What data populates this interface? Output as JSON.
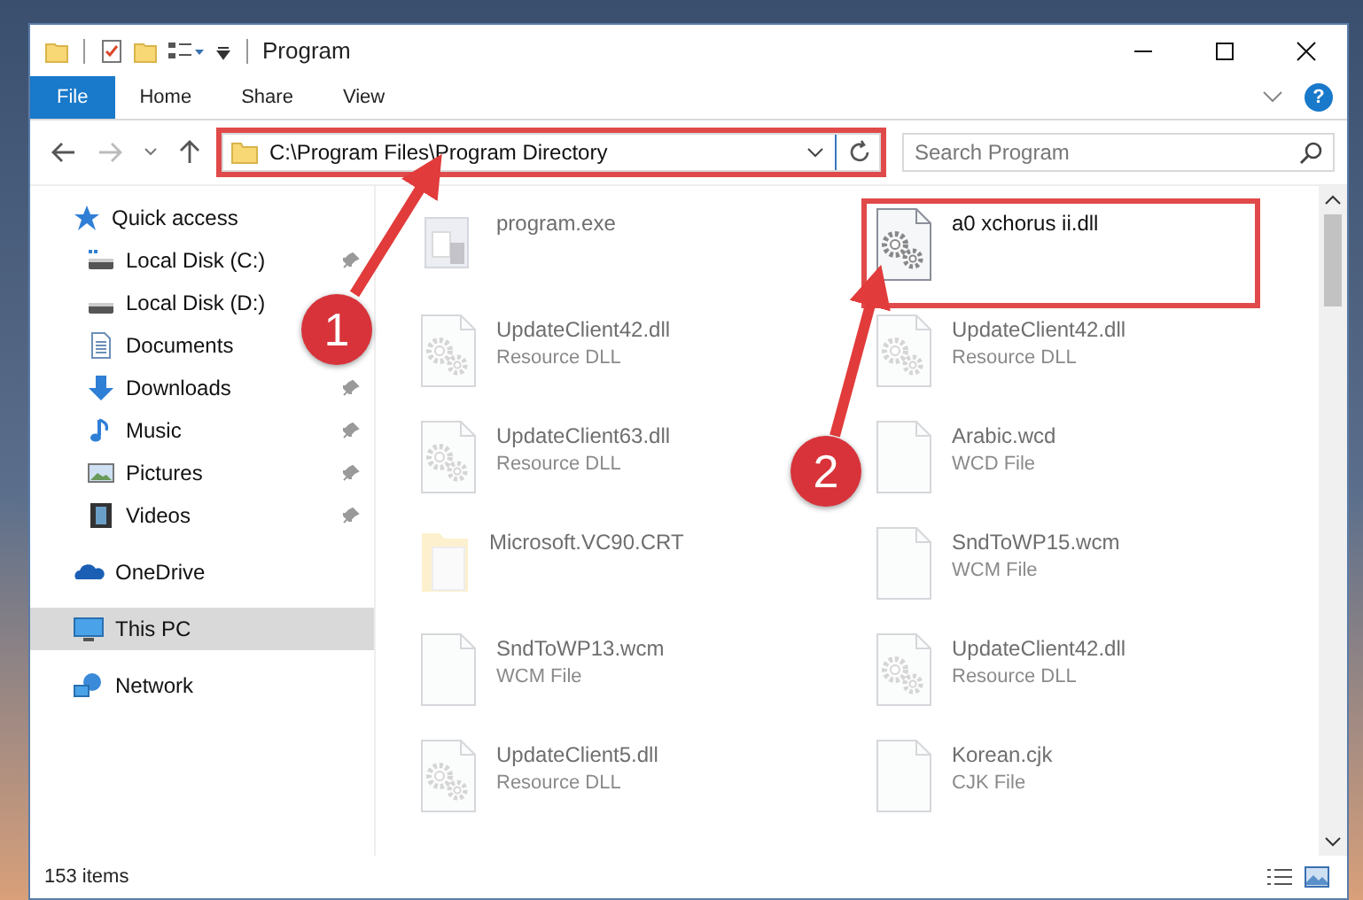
{
  "window": {
    "title": "Program"
  },
  "ribbon": {
    "tabs": [
      {
        "label": "File",
        "selected": true
      },
      {
        "label": "Home",
        "selected": false
      },
      {
        "label": "Share",
        "selected": false
      },
      {
        "label": "View",
        "selected": false
      }
    ],
    "help": "?"
  },
  "address": {
    "path": "C:\\Program Files\\Program Directory",
    "highlighted": true
  },
  "search": {
    "placeholder": "Search Program"
  },
  "sidebar": {
    "items": [
      {
        "label": "Quick access",
        "kind": "star",
        "selected": false,
        "children": [
          {
            "label": "Local Disk (C:)",
            "kind": "drive-c",
            "pinned": true
          },
          {
            "label": "Local Disk (D:)",
            "kind": "drive",
            "pinned": false
          },
          {
            "label": "Documents",
            "kind": "documents",
            "pinned": false
          },
          {
            "label": "Downloads",
            "kind": "downloads",
            "pinned": true
          },
          {
            "label": "Music",
            "kind": "music",
            "pinned": true
          },
          {
            "label": "Pictures",
            "kind": "pictures",
            "pinned": true
          },
          {
            "label": "Videos",
            "kind": "videos",
            "pinned": true
          }
        ]
      },
      {
        "label": "OneDrive",
        "kind": "cloud",
        "selected": false
      },
      {
        "label": "This PC",
        "kind": "pc",
        "selected": true
      },
      {
        "label": "Network",
        "kind": "network",
        "selected": false
      }
    ]
  },
  "files": [
    {
      "name": "program.exe",
      "kind": "exe",
      "dimmed": true,
      "highlighted": false
    },
    {
      "name": "a0 xchorus ii.dll",
      "kind": "dll",
      "dimmed": false,
      "highlighted": true
    },
    {
      "name": "UpdateClient42.dll",
      "type": "Resource DLL",
      "kind": "dll",
      "dimmed": true,
      "highlighted": false
    },
    {
      "name": "UpdateClient42.dll",
      "type": "Resource DLL",
      "kind": "dll",
      "dimmed": true,
      "highlighted": false
    },
    {
      "name": "UpdateClient63.dll",
      "type": "Resource DLL",
      "kind": "dll",
      "dimmed": true,
      "highlighted": false
    },
    {
      "name": "Arabic.wcd",
      "type": "WCD File",
      "kind": "file",
      "dimmed": true,
      "highlighted": false
    },
    {
      "name": "Microsoft.VC90.CRT",
      "kind": "folder",
      "dimmed": true,
      "highlighted": false
    },
    {
      "name": "SndToWP15.wcm",
      "type": "WCM File",
      "kind": "file",
      "dimmed": true,
      "highlighted": false
    },
    {
      "name": "SndToWP13.wcm",
      "type": "WCM File",
      "kind": "file",
      "dimmed": true,
      "highlighted": false
    },
    {
      "name": "UpdateClient42.dll",
      "type": "Resource DLL",
      "kind": "dll",
      "dimmed": true,
      "highlighted": false
    },
    {
      "name": "UpdateClient5.dll",
      "type": "Resource DLL",
      "kind": "dll",
      "dimmed": true,
      "highlighted": false
    },
    {
      "name": "Korean.cjk",
      "type": "CJK File",
      "kind": "file",
      "dimmed": true,
      "highlighted": false
    }
  ],
  "status_bar": {
    "count": "153 items"
  },
  "callouts": [
    {
      "number": "1"
    },
    {
      "number": "2"
    }
  ]
}
